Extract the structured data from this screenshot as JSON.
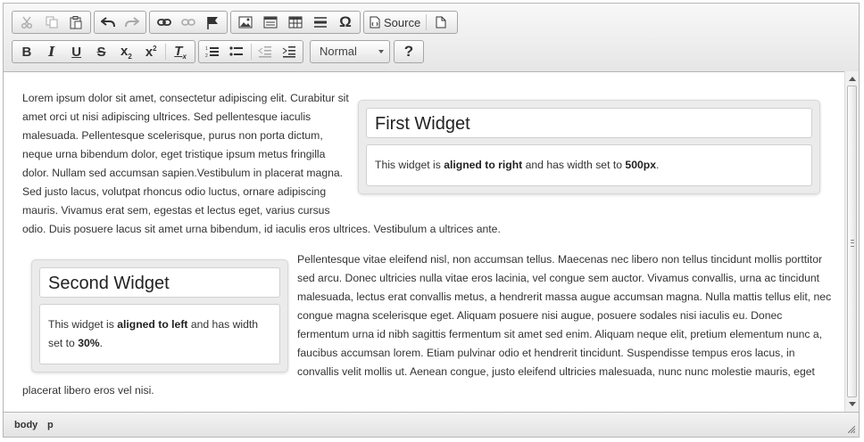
{
  "toolbar": {
    "source_label": "Source",
    "format_value": "Normal"
  },
  "widget1": {
    "title": "First Widget",
    "text_before": "This widget is ",
    "bold1": "aligned to right",
    "text_mid": " and has width set to ",
    "bold2": "500px",
    "text_after": "."
  },
  "widget2": {
    "title": "Second Widget",
    "text_before": "This widget is ",
    "bold1": "aligned to left",
    "text_mid": " and has width set to ",
    "bold2": "30%",
    "text_after": "."
  },
  "content": {
    "paragraph1": "Lorem ipsum dolor sit amet, consectetur adipiscing elit. Curabitur sit amet orci ut nisi adipiscing ultrices. Sed pellentesque iaculis malesuada. Pellentesque scelerisque, purus non porta dictum, neque urna bibendum dolor, eget tristique ipsum metus fringilla dolor. Nullam sed accumsan sapien.Vestibulum in placerat magna. Sed justo lacus, volutpat rhoncus odio luctus, ornare adipiscing mauris. Vivamus erat sem, egestas et lectus eget, varius cursus odio. Duis posuere lacus sit amet urna bibendum, id iaculis eros ultrices. Vestibulum a ultrices ante.",
    "paragraph2": "Pellentesque vitae eleifend nisl, non accumsan tellus. Maecenas nec libero non tellus tincidunt mollis porttitor sed arcu. Donec ultricies nulla vitae eros lacinia, vel congue sem auctor. Vivamus convallis, urna ac tincidunt malesuada, lectus erat convallis metus, a hendrerit massa augue accumsan magna. Nulla mattis tellus elit, nec congue magna scelerisque eget. Aliquam posuere nisi augue, posuere sodales nisi iaculis eu. Donec fermentum urna id nibh sagittis fermentum sit amet sed enim. Aliquam neque elit, pretium elementum nunc a, faucibus accumsan lorem. Etiam pulvinar odio et hendrerit tincidunt. Suspendisse tempus eros lacus, in convallis velit mollis ut. Aenean congue, justo eleifend ultricies malesuada, nunc nunc molestie mauris, eget placerat libero eros vel nisi."
  },
  "statusbar": {
    "crumbs": [
      "body",
      "p"
    ]
  }
}
